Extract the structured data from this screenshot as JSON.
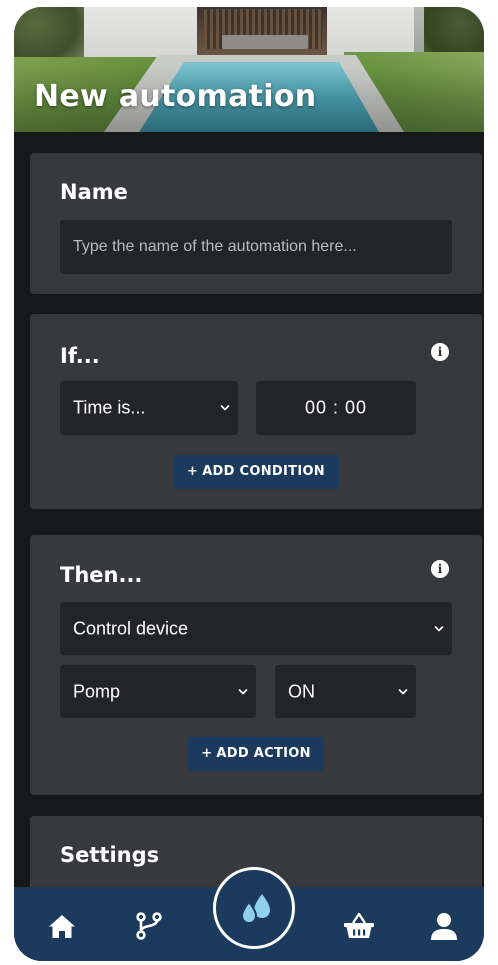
{
  "header": {
    "title": "New automation"
  },
  "name_card": {
    "title": "Name",
    "input_placeholder": "Type the name of the automation here...",
    "input_value": ""
  },
  "if_card": {
    "title": "If...",
    "condition_select": "Time is...",
    "time_value": "00 : 00",
    "add_condition_label": "ADD CONDITION",
    "plus": "+"
  },
  "then_card": {
    "title": "Then...",
    "action_select": "Control device",
    "device_select": "Pomp",
    "state_select": "ON",
    "add_action_label": "ADD ACTION",
    "plus": "+"
  },
  "settings_card": {
    "title": "Settings"
  },
  "bottom_nav": {
    "items": [
      {
        "icon": "home-icon"
      },
      {
        "icon": "branch-icon"
      },
      {
        "icon": "water-drops-icon"
      },
      {
        "icon": "basket-icon"
      },
      {
        "icon": "user-icon"
      }
    ]
  },
  "colors": {
    "background": "#17181a",
    "card": "#37393d",
    "field": "#232427",
    "accent": "#1b3a5e",
    "text": "#ffffff",
    "drop": "#8fd0ee"
  }
}
